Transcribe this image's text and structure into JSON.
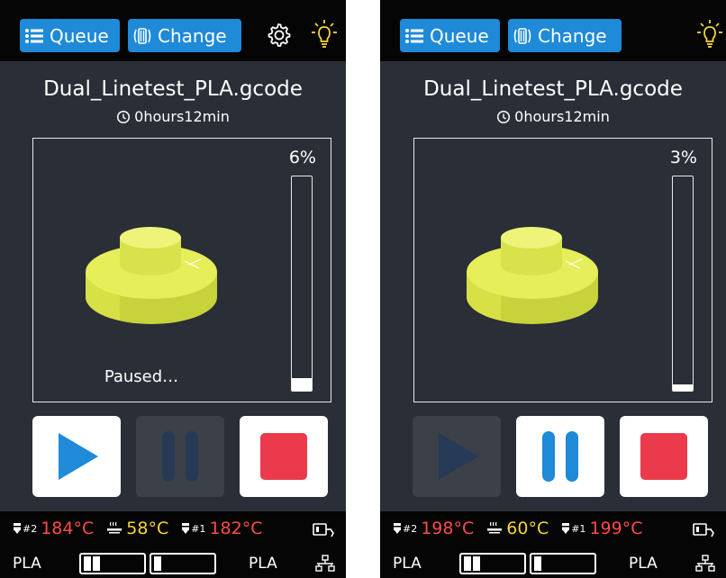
{
  "screens": [
    {
      "queue_label": "Queue",
      "change_label": "Change",
      "show_gear": true,
      "filename": "Dual_Linetest_PLA.gcode",
      "time": "0hours12min",
      "percent_text": "6%",
      "progress": 0.06,
      "status": "Paused…",
      "play_enabled": true,
      "pause_enabled": false,
      "temp_nozzle2_label": "#2",
      "temp_nozzle2": "184°C",
      "temp_bed": "58°C",
      "temp_nozzle1_label": "#1",
      "temp_nozzle1": "182°C",
      "filament_left": "PLA",
      "filament_right": "PLA"
    },
    {
      "queue_label": "Queue",
      "change_label": "Change",
      "show_gear": false,
      "filename": "Dual_Linetest_PLA.gcode",
      "time": "0hours12min",
      "percent_text": "3%",
      "progress": 0.03,
      "status": "",
      "play_enabled": false,
      "pause_enabled": true,
      "temp_nozzle2_label": "#2",
      "temp_nozzle2": "198°C",
      "temp_bed": "60°C",
      "temp_nozzle1_label": "#1",
      "temp_nozzle1": "199°C",
      "filament_left": "PLA",
      "filament_right": "PLA"
    }
  ],
  "colors": {
    "accent_blue": "#1e8ad8",
    "stop_red": "#ea3a4b",
    "temp_red": "#ff4a4a",
    "bed_yellow": "#f5d53a",
    "model_yellow": "#e6ee5a"
  },
  "icons": [
    "list-icon",
    "filament-change-icon",
    "gear-icon",
    "light-bulb-icon",
    "clock-icon",
    "play-icon",
    "pause-icon",
    "stop-icon",
    "nozzle-icon",
    "heated-bed-icon",
    "usb-icon",
    "network-icon"
  ]
}
